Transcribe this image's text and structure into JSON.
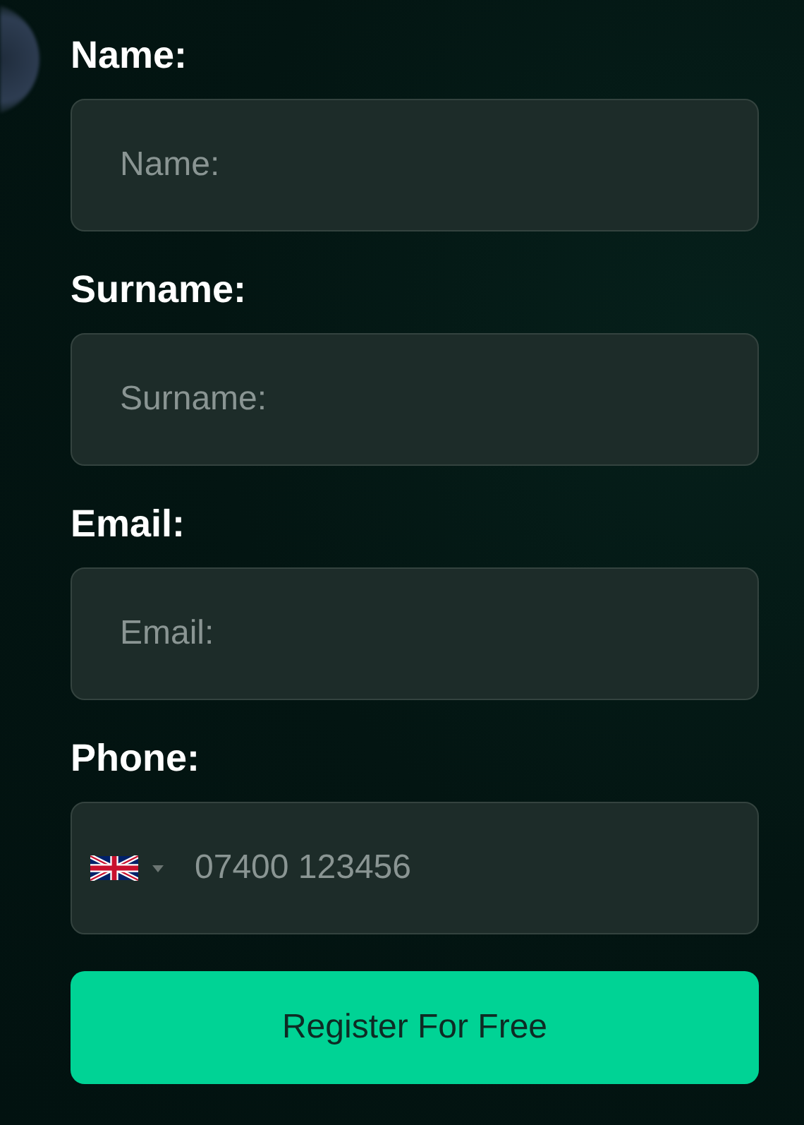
{
  "fields": [
    {
      "label": "Name:",
      "placeholder": "Name:",
      "kind": "text"
    },
    {
      "label": "Surname:",
      "placeholder": "Surname:",
      "kind": "text"
    },
    {
      "label": "Email:",
      "placeholder": "Email:",
      "kind": "text"
    },
    {
      "label": "Phone:",
      "placeholder": "07400 123456",
      "kind": "phone"
    }
  ],
  "submit": "Register For Free"
}
